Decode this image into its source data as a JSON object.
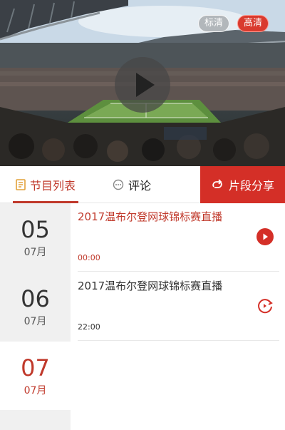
{
  "player": {
    "quality_sd": "标清",
    "quality_hd": "高清",
    "quality_selected": "高清"
  },
  "tabs": {
    "programs": "节目列表",
    "comments": "评论",
    "share": "片段分享"
  },
  "dates": [
    {
      "day": "05",
      "month": "07月"
    },
    {
      "day": "06",
      "month": "07月"
    },
    {
      "day": "07",
      "month": "07月"
    }
  ],
  "active_date": "07",
  "programs": [
    {
      "title": "2017温布尔登网球锦标赛直播",
      "time": "00:00",
      "icon": "play-circle-icon"
    },
    {
      "title": "2017温布尔登网球锦标赛直播",
      "time": "22:00",
      "icon": "replay-icon"
    }
  ],
  "colors": {
    "accent": "#c0392b",
    "share_bg": "#d42f27",
    "date_bg": "#f0f0f0"
  }
}
